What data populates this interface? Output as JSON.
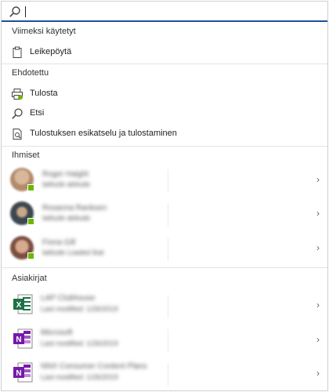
{
  "search": {
    "value": ""
  },
  "recent": {
    "header": "Viimeksi käytetyt",
    "items": [
      {
        "label": "Leikepöytä",
        "icon": "clipboard-icon"
      }
    ]
  },
  "suggested": {
    "header": "Ehdotettu",
    "items": [
      {
        "label": "Tulosta",
        "icon": "print-icon"
      },
      {
        "label": "Etsi",
        "icon": "search-icon"
      },
      {
        "label": "Tulostuksen esikatselu ja tulostaminen",
        "icon": "print-preview-icon"
      }
    ]
  },
  "people": {
    "header": "Ihmiset",
    "items": [
      {
        "name": "Roger Haight",
        "detail": "latitude abitude",
        "avatar_color": "#b08a6a",
        "presence": "#6bb700"
      },
      {
        "name": "Rosanna Ranksen",
        "detail": "latitude abitude",
        "avatar_color": "#3d4750",
        "presence": "#6bb700"
      },
      {
        "name": "Fiona Gill",
        "detail": "latitude Loaded Ikat",
        "avatar_color": "#9a6d5a",
        "presence": "#6bb700"
      }
    ]
  },
  "documents": {
    "header": "Asiakirjat",
    "items": [
      {
        "name": "LAP Clubhouse",
        "detail": "Last modified: 1/26/2019",
        "app": "excel",
        "color": "#1e7145"
      },
      {
        "name": "Microsoft",
        "detail": "Last modified: 1/26/2019",
        "app": "onenote",
        "color": "#7719aa"
      },
      {
        "name": "NNX Consumer Content Plans",
        "detail": "Last modified: 1/26/2019",
        "app": "onenote",
        "color": "#7719aa"
      }
    ]
  },
  "colors": {
    "search_underline": "#1f4e9a",
    "presence_green": "#6bb700",
    "excel_green": "#1e7145",
    "onenote_purple": "#7719aa"
  }
}
